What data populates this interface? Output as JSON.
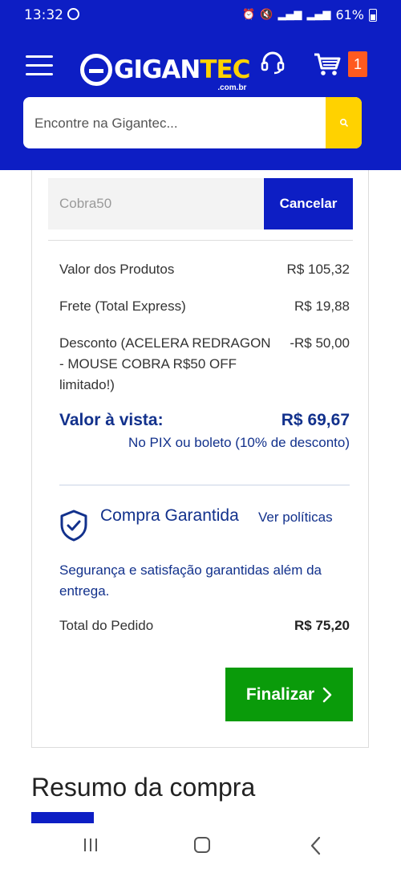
{
  "status_bar": {
    "time": "13:32",
    "battery": "61%"
  },
  "header": {
    "logo_prefix": "GIGAN",
    "logo_suffix": "TEC",
    "logo_domain": ".com.br",
    "cart_count": "1",
    "search_placeholder": "Encontre na Gigantec..."
  },
  "coupon": {
    "code": "Cobra50",
    "cancel_label": "Cancelar"
  },
  "summary": {
    "products_label": "Valor dos Produtos",
    "products_value": "R$ 105,32",
    "shipping_label": "Frete (Total Express)",
    "shipping_value": "R$ 19,88",
    "discount_label": "Desconto (ACELERA REDRAGON - MOUSE COBRA R$50 OFF limitado!)",
    "discount_value": "-R$ 50,00",
    "cash_label": "Valor à vista:",
    "cash_value": "R$ 69,67",
    "cash_note": "No PIX ou boleto (10% de desconto)"
  },
  "guarantee": {
    "title": "Compra Garantida",
    "link": "Ver políticas",
    "description": "Segurança e satisfação garantidas além da entrega."
  },
  "total": {
    "label": "Total do Pedido",
    "value": "R$ 75,20"
  },
  "finalize_label": "Finalizar",
  "section_title": "Resumo da compra",
  "colors": {
    "brand_blue": "#0d1ec4",
    "brand_yellow": "#ffd200",
    "finalize_green": "#0a9b0a",
    "cart_badge": "#ff5a1f",
    "text_navy": "#12318c"
  }
}
